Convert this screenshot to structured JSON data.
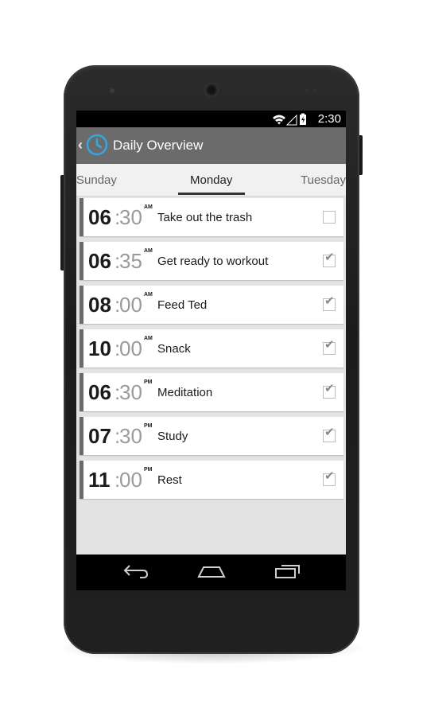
{
  "status_bar": {
    "time": "2:30",
    "icons": [
      "wifi-icon",
      "signal-icon",
      "battery-icon"
    ]
  },
  "action_bar": {
    "title": "Daily Overview",
    "icon": "clock-icon",
    "up_icon": "chevron-left-icon"
  },
  "tabs": {
    "left": "Sunday",
    "center": "Monday",
    "right": "Tuesday",
    "selected": "Monday"
  },
  "tasks": [
    {
      "hh": "06",
      "mm": "30",
      "ampm": "AM",
      "label": "Take out the trash",
      "checked": false
    },
    {
      "hh": "06",
      "mm": "35",
      "ampm": "AM",
      "label": "Get ready to workout",
      "checked": true
    },
    {
      "hh": "08",
      "mm": "00",
      "ampm": "AM",
      "label": "Feed Ted",
      "checked": true
    },
    {
      "hh": "10",
      "mm": "00",
      "ampm": "AM",
      "label": "Snack",
      "checked": true
    },
    {
      "hh": "06",
      "mm": "30",
      "ampm": "PM",
      "label": "Meditation",
      "checked": true
    },
    {
      "hh": "07",
      "mm": "30",
      "ampm": "PM",
      "label": "Study",
      "checked": true
    },
    {
      "hh": "11",
      "mm": "00",
      "ampm": "PM",
      "label": "Rest",
      "checked": true
    }
  ],
  "nav_bar": {
    "buttons": [
      "back-icon",
      "home-icon",
      "recent-apps-icon"
    ]
  },
  "colors": {
    "action_bar": "#6b6b6b",
    "accent_icon": "#35a7e0",
    "list_background": "#e3e3e3",
    "card_bar": "#6a6a6a"
  }
}
